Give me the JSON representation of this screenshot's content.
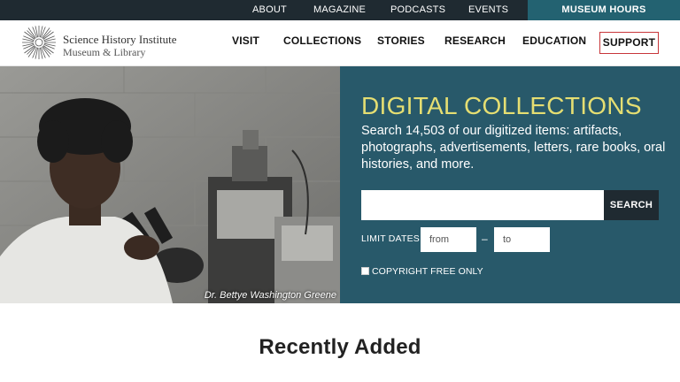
{
  "utility_nav": {
    "items": [
      "ABOUT",
      "MAGAZINE",
      "PODCASTS",
      "EVENTS"
    ],
    "hours_label": "MUSEUM HOURS"
  },
  "logo": {
    "line1": "Science History Institute",
    "line2": "Museum & Library"
  },
  "main_nav": {
    "items": [
      "VISIT",
      "COLLECTIONS",
      "STORIES",
      "RESEARCH",
      "EDUCATION"
    ],
    "support_label": "SUPPORT"
  },
  "hero": {
    "caption": "Dr. Bettye Washington Greene"
  },
  "collections": {
    "title": "DIGITAL COLLECTIONS",
    "description": "Search 14,503 of our digitized items: artifacts, photographs, advertisements, letters, rare books, oral histories, and more.",
    "search_value": "",
    "search_button": "SEARCH",
    "limit_label": "LIMIT DATES",
    "from_placeholder": "from",
    "dash": "–",
    "to_placeholder": "to",
    "copyright_label": "COPYRIGHT FREE ONLY",
    "copyright_checked": false
  },
  "recent": {
    "heading": "Recently Added"
  },
  "colors": {
    "utility_bg": "#1f2a31",
    "hours_bg": "#236271",
    "panel_bg": "#28596a",
    "title_yellow": "#e5de72",
    "support_border": "#c8363a"
  }
}
